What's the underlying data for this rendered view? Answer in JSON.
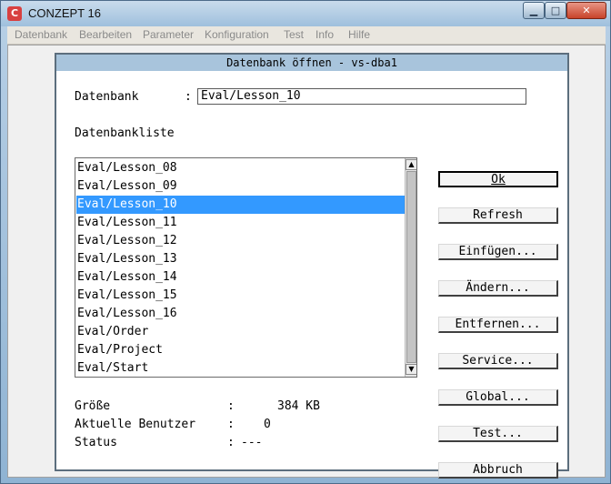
{
  "window": {
    "title": "CONZEPT 16",
    "buttons": {
      "minimize": "▁",
      "maximize": "□",
      "close": "✕"
    }
  },
  "menu": [
    "Datenbank",
    "Bearbeiten",
    "Parameter",
    "Konfiguration",
    "Test",
    "Info",
    "Hilfe"
  ],
  "dialog": {
    "title": "Datenbank öffnen - vs-dba1",
    "database_label": "Datenbank",
    "database_colon": ":",
    "database_value": "Eval/Lesson_10",
    "list_label": "Datenbankliste",
    "list_items": [
      "Eval/Lesson_08",
      "Eval/Lesson_09",
      "Eval/Lesson_10",
      "Eval/Lesson_11",
      "Eval/Lesson_12",
      "Eval/Lesson_13",
      "Eval/Lesson_14",
      "Eval/Lesson_15",
      "Eval/Lesson_16",
      "Eval/Order",
      "Eval/Project",
      "Eval/Start"
    ],
    "selected_item": "Eval/Lesson_10",
    "scroll_up": "▲",
    "scroll_down": "▼",
    "buttons": [
      "Ok",
      "Refresh",
      "Einfügen...",
      "Ändern...",
      "Entfernen...",
      "Service...",
      "Global...",
      "Test...",
      "Abbruch"
    ],
    "info": [
      {
        "label": "Größe",
        "colon": ":",
        "value": "384 KB"
      },
      {
        "label": "Aktuelle Benutzer",
        "colon": ":",
        "value": "0"
      },
      {
        "label": "Status",
        "colon": ":",
        "value": "---"
      }
    ]
  },
  "colors": {
    "selection": "#3399ff",
    "dialog_title": "#a8c4dc"
  },
  "icons": {
    "app": "conzept-app-icon"
  }
}
